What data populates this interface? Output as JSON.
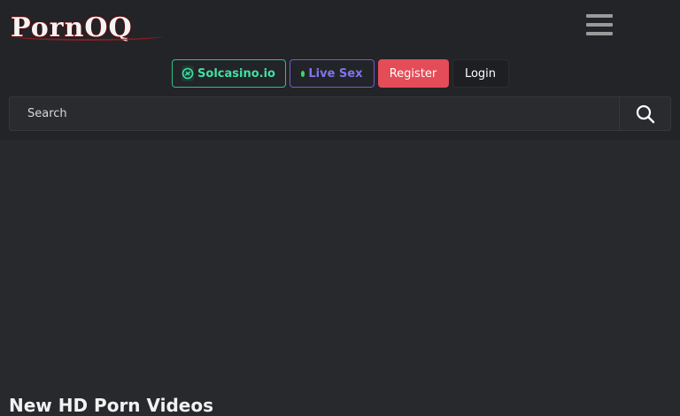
{
  "header": {
    "logo_text": "PornOQ"
  },
  "nav_buttons": {
    "solcasino_label": "Solcasino.io",
    "live_label": "Live Sex",
    "register_label": "Register",
    "login_label": "Login"
  },
  "search": {
    "placeholder": "Search"
  },
  "main": {
    "section_title": "New HD Porn Videos"
  },
  "colors": {
    "accent_green": "#3ee0a3",
    "accent_purple": "#7f74f0",
    "register_red": "#e44c57",
    "live_dot": "#3fd46a"
  }
}
